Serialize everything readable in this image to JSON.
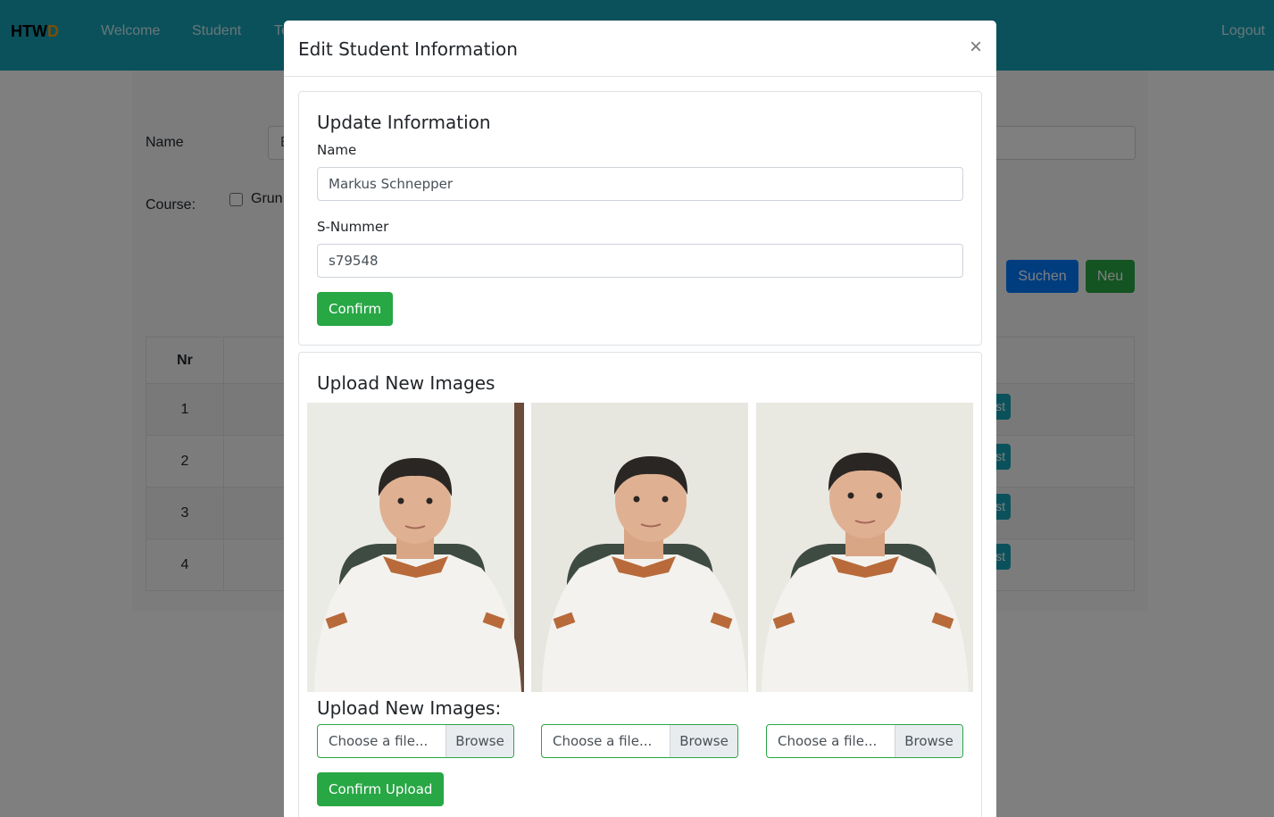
{
  "navbar": {
    "brand": "HTW",
    "brand_accent": "D",
    "links": [
      "Welcome",
      "Student",
      "Te"
    ],
    "logout": "Logout"
  },
  "search_form": {
    "name_label": "Name",
    "name_value": "E",
    "course_label": "Course:",
    "course_option": "Grun",
    "search_button": "Suchen",
    "new_button": "Neu"
  },
  "table": {
    "header_nr": "Nr",
    "rows": [
      "1",
      "2",
      "3",
      "4"
    ],
    "row_button": "st"
  },
  "modal": {
    "title": "Edit Student Information",
    "close": "×",
    "update": {
      "title": "Update Information",
      "name_label": "Name",
      "name_value": "Markus Schnepper",
      "snummer_label": "S-Nummer",
      "snummer_value": "s79548",
      "confirm": "Confirm"
    },
    "upload": {
      "title": "Upload New Images",
      "subtitle": "Upload New Images:",
      "file_placeholder": "Choose a file...",
      "browse": "Browse",
      "confirm": "Confirm Upload"
    }
  },
  "colors": {
    "navbar": "#17a2b8",
    "success": "#28a745",
    "primary": "#007bff"
  }
}
